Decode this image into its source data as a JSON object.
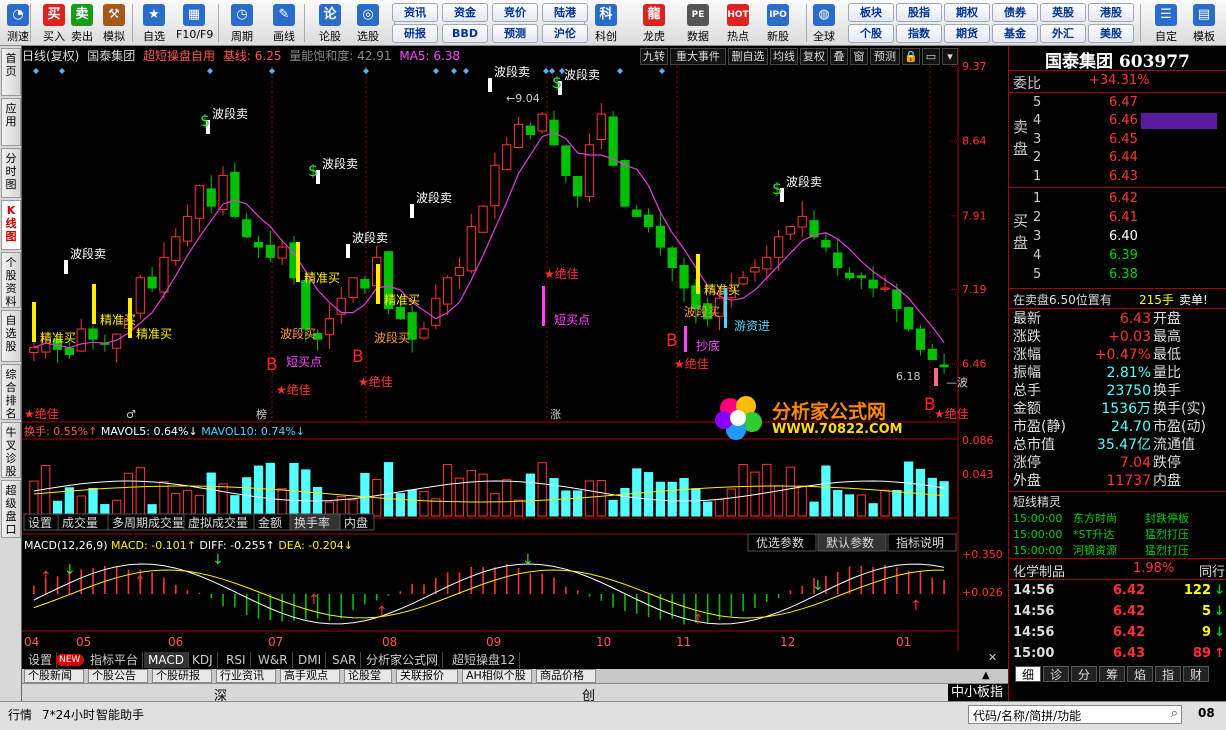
{
  "toolbar": {
    "buttons": [
      {
        "label": "测速",
        "icon": "speed-test-icon",
        "color": "#2a6cc9"
      },
      {
        "label": "买入",
        "icon": "buy-icon",
        "color": "#d22"
      },
      {
        "label": "卖出",
        "icon": "sell-icon",
        "color": "#1a9a1a"
      },
      {
        "label": "模拟",
        "icon": "hammer-icon",
        "color": "#a55a1a"
      },
      {
        "label": "自选",
        "icon": "watchlist-icon",
        "color": "#2a6cc9"
      },
      {
        "label": "F10/F9",
        "icon": "f10-icon",
        "color": "#2a6cc9"
      },
      {
        "label": "周期",
        "icon": "clock-icon",
        "color": "#2a6cc9"
      },
      {
        "label": "画线",
        "icon": "pen-icon",
        "color": "#2a6cc9"
      },
      {
        "label": "论股",
        "icon": "discuss-icon",
        "color": "#2a6cc9"
      },
      {
        "label": "选股",
        "icon": "stock-pick-icon",
        "color": "#2a6cc9"
      },
      {
        "label": "科创",
        "icon": "kechuang-icon",
        "color": "#2a6cc9"
      },
      {
        "label": "龙虎",
        "icon": "dragon-tiger-icon",
        "color": "#d22"
      },
      {
        "label": "数据",
        "icon": "pe-data-icon",
        "color": "#555"
      },
      {
        "label": "热点",
        "icon": "hot-icon",
        "color": "#d22"
      },
      {
        "label": "新股",
        "icon": "ipo-icon",
        "color": "#2a6cc9"
      },
      {
        "label": "全球",
        "icon": "globe-icon",
        "color": "#2a6cc9"
      },
      {
        "label": "自定",
        "icon": "custom-icon",
        "color": "#2a6cc9"
      },
      {
        "label": "模板",
        "icon": "template-icon",
        "color": "#2a6cc9"
      }
    ],
    "pills": [
      "资讯",
      "资金",
      "竞价",
      "陆港",
      "研报",
      "BBD",
      "预测",
      "沪伦",
      "板块",
      "股指",
      "期权",
      "债券",
      "英股",
      "港股",
      "个股",
      "指数",
      "期货",
      "基金",
      "外汇",
      "美股"
    ]
  },
  "left_tabs": [
    "首页",
    "应用",
    "分时图",
    "K线图",
    "个股资料",
    "自选股",
    "综合排名",
    "牛叉诊股",
    "超级盘口"
  ],
  "info": {
    "period": "日线(复权)",
    "name": "国泰集团",
    "indicator": "超短操盘自用",
    "base_label": "基线: ",
    "base_value": "6.25",
    "vol_label": "量能饱和度: ",
    "vol_value": "42.91",
    "ma_label": "MA5: ",
    "ma_value": "6.38"
  },
  "chart_buttons": [
    "九转",
    "重大事件",
    "删自选",
    "均线",
    "复权",
    "叠",
    "窗",
    "预测"
  ],
  "price_axis": [
    "9.37",
    "8.64",
    "7.91",
    "7.19",
    "6.46"
  ],
  "volume_axis": [
    "0.086",
    "0.043"
  ],
  "macd_axis": [
    "+0.350",
    "+0.026"
  ],
  "months": [
    "04",
    "05",
    "06",
    "07",
    "08",
    "09",
    "10",
    "11",
    "12",
    "01"
  ],
  "signals": {
    "wave_sell": "波段卖",
    "precise_buy": "精准买",
    "wave_buy": "波段买",
    "short_buy": "短买点",
    "absolute": "★绝佳",
    "bottom": "抄底",
    "swim": "游资进",
    "max_price": "9.04",
    "min_price": "6.18"
  },
  "chart_markers": [
    "榜",
    "涨"
  ],
  "volume": {
    "label_a": "换手: ",
    "value_a": "0.55%",
    "label_b": "MAVOL5: ",
    "value_b": "0.64%",
    "label_c": "MAVOL10: ",
    "value_c": "0.74%"
  },
  "vol_tabs": [
    "设置",
    "成交量",
    "多周期成交量",
    "虚拟成交量",
    "金额",
    "换手率",
    "内盘"
  ],
  "macd": {
    "name": "MACD(12,26,9)",
    "macd_label": "MACD: ",
    "macd_value": "-0.101",
    "diff_label": "DIFF: ",
    "diff_value": "-0.255",
    "dea_label": "DEA: ",
    "dea_value": "-0.204"
  },
  "macd_buttons": [
    "优选参数",
    "默认参数",
    "指标说明"
  ],
  "quote": {
    "title": "国泰集团 603977",
    "weibi_label": "委比",
    "weibi_value": "+34.31%",
    "sell_label": "卖盘",
    "buy_label": "买盘",
    "asks": [
      {
        "n": "5",
        "p": "6.47"
      },
      {
        "n": "4",
        "p": "6.46"
      },
      {
        "n": "3",
        "p": "6.45"
      },
      {
        "n": "2",
        "p": "6.44"
      },
      {
        "n": "1",
        "p": "6.43"
      }
    ],
    "bids": [
      {
        "n": "1",
        "p": "6.42"
      },
      {
        "n": "2",
        "p": "6.41"
      },
      {
        "n": "3",
        "p": "6.40"
      },
      {
        "n": "4",
        "p": "6.39"
      },
      {
        "n": "5",
        "p": "6.38"
      }
    ],
    "queue_text": "在卖盘6.50位置有",
    "queue_qty": "215手",
    "queue_tail": "卖单!",
    "stats": [
      {
        "l": "最新",
        "v": "6.43",
        "r": "开盘"
      },
      {
        "l": "涨跌",
        "v": "+0.03",
        "r": "最高"
      },
      {
        "l": "涨幅",
        "v": "+0.47%",
        "r": "最低"
      },
      {
        "l": "振幅",
        "v": "2.81%",
        "r": "量比"
      },
      {
        "l": "总手",
        "v": "23750",
        "r": "换手"
      },
      {
        "l": "金额",
        "v": "1536万",
        "r": "换手(实)"
      },
      {
        "l": "市盈(静)",
        "v": "24.70",
        "r": "市盈(动)"
      },
      {
        "l": "总市值",
        "v": "35.47亿",
        "r": "流通值"
      },
      {
        "l": "涨停",
        "v": "7.04",
        "r": "跌停"
      },
      {
        "l": "外盘",
        "v": "11737",
        "r": "内盘"
      }
    ],
    "elf_title": "短线精灵",
    "elf": [
      {
        "t": "15:00:00",
        "n": "东方时尚",
        "s": "封跌停板"
      },
      {
        "t": "15:00:00",
        "n": "*ST升达",
        "s": "猛烈打压"
      },
      {
        "t": "15:00:00",
        "n": "河钢资源",
        "s": "猛烈打压"
      }
    ],
    "industry": "化学制品",
    "industry_pct": "1.98%",
    "industry_r": "同行",
    "ticks": [
      {
        "t": "14:56",
        "p": "6.42",
        "q": "122",
        "d": "↓"
      },
      {
        "t": "14:56",
        "p": "6.42",
        "q": "5",
        "d": "↓"
      },
      {
        "t": "14:56",
        "p": "6.42",
        "q": "9",
        "d": "↓"
      },
      {
        "t": "15:00",
        "p": "6.43",
        "q": "89",
        "d": "↑"
      }
    ],
    "bottom_tabs": [
      "细",
      "诊",
      "分",
      "筹",
      "焰",
      "指",
      "财"
    ]
  },
  "bottom_tabs": [
    "设置",
    "NEW",
    "指标平台",
    "MACD",
    "KDJ",
    "RSI",
    "W&R",
    "DMI",
    "SAR",
    "分析家公式网",
    "超短操盘12"
  ],
  "news_tabs": [
    "个股新闻",
    "个股公告",
    "个股研报",
    "行业资讯",
    "高手观点",
    "论股堂",
    "关联报价",
    "AH相似个股",
    "商品价格"
  ],
  "scroll": {
    "left": "深",
    "mid": "创",
    "right": "中小板指"
  },
  "status": {
    "a": "行情",
    "b": "7*24小时",
    "c": "智能助手",
    "search": "代码/名称/简拼/功能",
    "time": "08"
  },
  "watermark": {
    "title": "分析家公式网",
    "url": "WWW.70822.COM"
  },
  "colors": {
    "up": "#ff3232",
    "down": "#54ffff",
    "green": "#00c000",
    "yellow": "#ffff00",
    "magenta": "#ff00ff",
    "accent": "#aa0000"
  },
  "chart_data": {
    "type": "candlestick",
    "price_range": [
      5.9,
      9.37
    ],
    "months": [
      "04",
      "05",
      "06",
      "07",
      "08",
      "09",
      "10",
      "11",
      "12",
      "01"
    ],
    "closes": [
      6.62,
      6.7,
      6.6,
      6.55,
      6.8,
      6.7,
      6.65,
      6.75,
      6.9,
      7.3,
      7.2,
      7.5,
      7.7,
      7.9,
      8.2,
      8.0,
      8.3,
      7.9,
      7.7,
      7.6,
      7.5,
      7.6,
      7.3,
      6.8,
      6.7,
      6.9,
      7.1,
      7.3,
      7.2,
      7.5,
      7.0,
      6.9,
      6.7,
      6.8,
      7.1,
      7.3,
      7.4,
      7.8,
      8.0,
      8.4,
      8.6,
      8.8,
      8.7,
      8.9,
      8.6,
      8.3,
      8.1,
      8.6,
      8.9,
      8.4,
      8.0,
      7.9,
      7.8,
      7.6,
      7.4,
      7.2,
      7.0,
      6.9,
      7.1,
      7.2,
      7.3,
      7.4,
      7.5,
      7.7,
      7.8,
      7.9,
      7.7,
      7.6,
      7.4,
      7.3,
      7.3,
      7.2,
      7.2,
      7.0,
      6.8,
      6.6,
      6.5,
      6.43
    ]
  }
}
